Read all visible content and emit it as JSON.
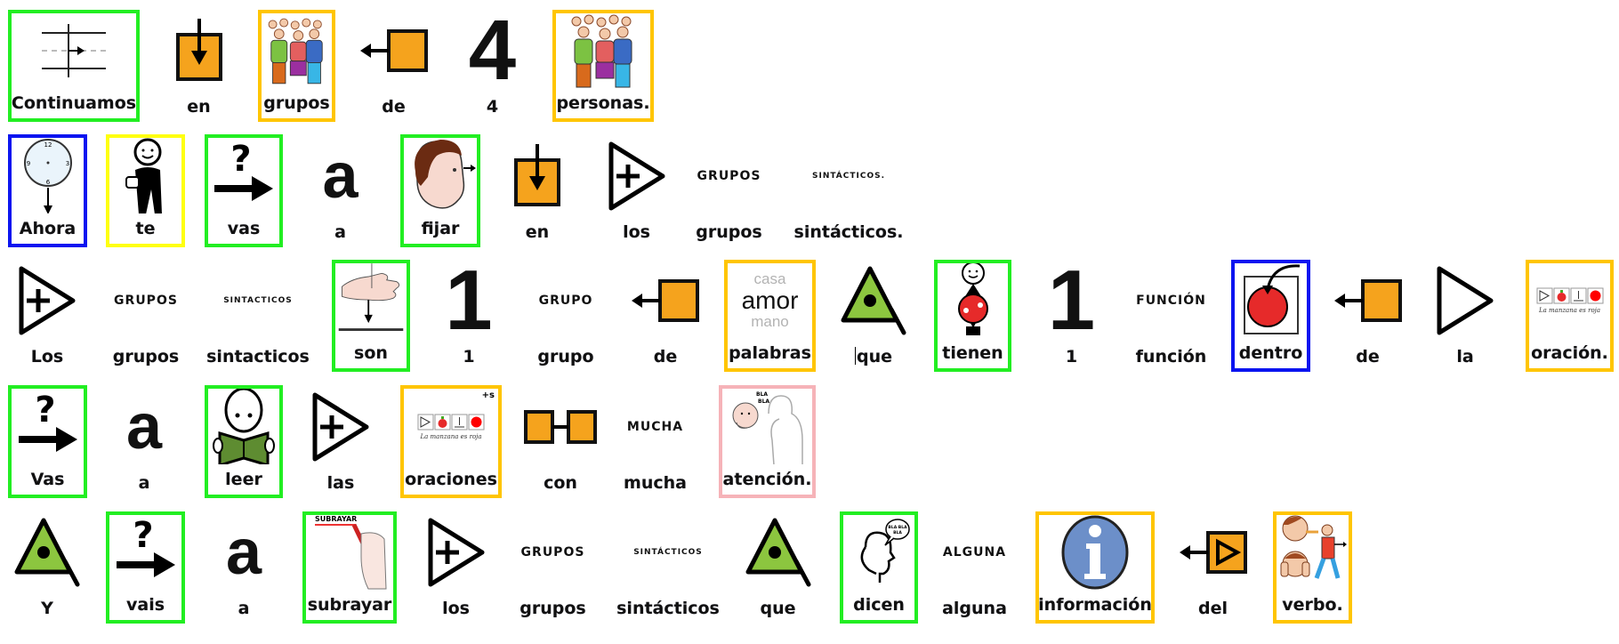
{
  "document": {
    "type": "pictogram-sentence-board",
    "frame_colors": {
      "green": "#22ee22",
      "orange": "#ffc500",
      "blue": "#0a14f0",
      "yellow": "#ffff10",
      "pink": "#f6b3b8",
      "none": "transparent"
    },
    "accent_colors": {
      "pictogram_orange": "#f5a31d",
      "pictogram_green": "#8cc63f",
      "pictogram_red": "#e62a2a",
      "info_blue": "#6c8fc9"
    },
    "rows": [
      {
        "sentence": "Continuamos en grupos de 4 personas.",
        "cells": [
          {
            "label": "Continuamos",
            "icon": "continue-lines-icon",
            "frame": "green"
          },
          {
            "label": "en",
            "icon": "in-box-arrow-icon",
            "frame": "none"
          },
          {
            "label": "grupos",
            "icon": "group-people-icon",
            "frame": "orange"
          },
          {
            "label": "de",
            "icon": "from-box-arrow-left-icon",
            "frame": "none"
          },
          {
            "label": "4",
            "icon": "number-icon",
            "icon_text": "4",
            "frame": "none"
          },
          {
            "label": "personas.",
            "icon": "group-people-icon",
            "frame": "orange"
          }
        ]
      },
      {
        "sentence": "Ahora te vas a fijar en los grupos sintácticos.",
        "cells": [
          {
            "label": "Ahora",
            "icon": "clock-now-icon",
            "frame": "blue"
          },
          {
            "label": "te",
            "icon": "person-pointing-you-icon",
            "frame": "yellow"
          },
          {
            "label": "vas",
            "icon": "question-arrow-icon",
            "frame": "green"
          },
          {
            "label": "a",
            "icon": "letter-a-icon",
            "icon_text": "a",
            "frame": "none"
          },
          {
            "label": "fijar",
            "icon": "head-looking-icon",
            "frame": "green"
          },
          {
            "label": "en",
            "icon": "in-box-arrow-icon",
            "frame": "none"
          },
          {
            "label": "los",
            "icon": "article-plural-triangle-icon",
            "frame": "none"
          },
          {
            "label": "grupos",
            "icon": "word-text-icon",
            "icon_text": "GRUPOS",
            "frame": "none"
          },
          {
            "label": "sintácticos.",
            "icon": "word-text-icon",
            "icon_text": "SINTÁCTICOS.",
            "frame": "none"
          }
        ]
      },
      {
        "sentence": "Los grupos sintacticos son 1 grupo de palabras que tienen 1 función dentro de la oración.",
        "cells": [
          {
            "label": "Los",
            "icon": "article-plural-triangle-icon",
            "frame": "none"
          },
          {
            "label": "grupos",
            "icon": "word-text-icon",
            "icon_text": "GRUPOS",
            "frame": "none"
          },
          {
            "label": "sintacticos",
            "icon": "word-text-icon",
            "icon_text": "SINTACTICOS",
            "frame": "none"
          },
          {
            "label": "son",
            "icon": "hand-place-down-icon",
            "frame": "green"
          },
          {
            "label": "1",
            "icon": "number-icon",
            "icon_text": "1",
            "frame": "none"
          },
          {
            "label": "grupo",
            "icon": "word-text-icon",
            "icon_text": "GRUPO",
            "frame": "none"
          },
          {
            "label": "de",
            "icon": "from-box-arrow-left-icon",
            "frame": "none"
          },
          {
            "label": "palabras",
            "icon": "words-list-icon",
            "icon_words": [
              "casa",
              "amor",
              "mano"
            ],
            "frame": "orange"
          },
          {
            "label": "que",
            "icon": "relative-pronoun-triangle-icon",
            "frame": "none",
            "has_caret": true
          },
          {
            "label": "tienen",
            "icon": "person-holding-ball-icon",
            "frame": "green"
          },
          {
            "label": "1",
            "icon": "number-icon",
            "icon_text": "1",
            "frame": "none"
          },
          {
            "label": "función",
            "icon": "word-text-icon",
            "icon_text": "FUNCIÓN",
            "frame": "none"
          },
          {
            "label": "dentro",
            "icon": "inside-box-ball-icon",
            "frame": "blue"
          },
          {
            "label": "de",
            "icon": "from-box-arrow-left-icon",
            "frame": "none"
          },
          {
            "label": "la",
            "icon": "article-singular-triangle-icon",
            "frame": "none"
          },
          {
            "label": "oración.",
            "icon": "sentence-pictograms-icon",
            "icon_caption": "La manzana es roja",
            "frame": "orange"
          }
        ]
      },
      {
        "sentence": "Vas a leer las oraciones con mucha atención.",
        "cells": [
          {
            "label": "Vas",
            "icon": "question-arrow-icon",
            "frame": "green"
          },
          {
            "label": "a",
            "icon": "letter-a-icon",
            "icon_text": "a",
            "frame": "none"
          },
          {
            "label": "leer",
            "icon": "person-reading-book-icon",
            "frame": "green"
          },
          {
            "label": "las",
            "icon": "article-plural-triangle-icon",
            "frame": "none"
          },
          {
            "label": "oraciones",
            "icon": "sentence-pictograms-icon",
            "icon_caption": "La manzana es roja",
            "plural_mark": "+s",
            "frame": "orange"
          },
          {
            "label": "con",
            "icon": "with-linked-boxes-icon",
            "frame": "none"
          },
          {
            "label": "mucha",
            "icon": "word-text-icon",
            "icon_text": "MUCHA",
            "frame": "none"
          },
          {
            "label": "atención.",
            "icon": "person-listening-icon",
            "frame": "pink"
          }
        ]
      },
      {
        "sentence": "Y vais a subrayar los grupos sintácticos que dicen alguna información del verbo.",
        "cells": [
          {
            "label": "Y",
            "icon": "relative-pronoun-triangle-icon",
            "frame": "none"
          },
          {
            "label": "vais",
            "icon": "question-arrow-icon",
            "frame": "green"
          },
          {
            "label": "a",
            "icon": "letter-a-icon",
            "icon_text": "a",
            "frame": "none"
          },
          {
            "label": "subrayar",
            "icon": "hand-underline-icon",
            "icon_text": "SUBRAYAR",
            "frame": "green"
          },
          {
            "label": "los",
            "icon": "article-plural-triangle-icon",
            "frame": "none"
          },
          {
            "label": "grupos",
            "icon": "word-text-icon",
            "icon_text": "GRUPOS",
            "frame": "none"
          },
          {
            "label": "sintácticos",
            "icon": "word-text-icon",
            "icon_text": "SINTÁCTICOS",
            "frame": "none"
          },
          {
            "label": "que",
            "icon": "relative-pronoun-triangle-icon",
            "frame": "none"
          },
          {
            "label": "dicen",
            "icon": "head-speaking-icon",
            "frame": "green"
          },
          {
            "label": "alguna",
            "icon": "word-text-icon",
            "icon_text": "ALGUNA",
            "frame": "none"
          },
          {
            "label": "información",
            "icon": "info-icon",
            "frame": "orange"
          },
          {
            "label": "del",
            "icon": "of-the-box-arrow-icon",
            "frame": "none"
          },
          {
            "label": "verbo.",
            "icon": "verb-actions-icon",
            "frame": "orange"
          }
        ]
      }
    ]
  }
}
